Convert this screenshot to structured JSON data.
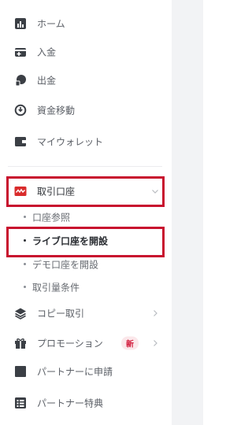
{
  "menu": {
    "home": "ホーム",
    "deposit": "入金",
    "withdraw": "出金",
    "transfer": "資金移動",
    "wallet": "マイウォレット",
    "accounts": "取引口座",
    "copy_trade": "コピー取引",
    "promotion": "プロモーション",
    "promotion_badge": "新",
    "partner_apply": "パートナーに申請",
    "partner_benefit": "パートナー特典"
  },
  "submenu": [
    {
      "label": "口座参照"
    },
    {
      "label": "ライブ口座を開設"
    },
    {
      "label": "デモ口座を開設"
    },
    {
      "label": "取引量条件"
    }
  ],
  "colors": {
    "highlight": "#c8102e",
    "accent_icon": "#d92b2b",
    "icon": "#3b3f45"
  }
}
